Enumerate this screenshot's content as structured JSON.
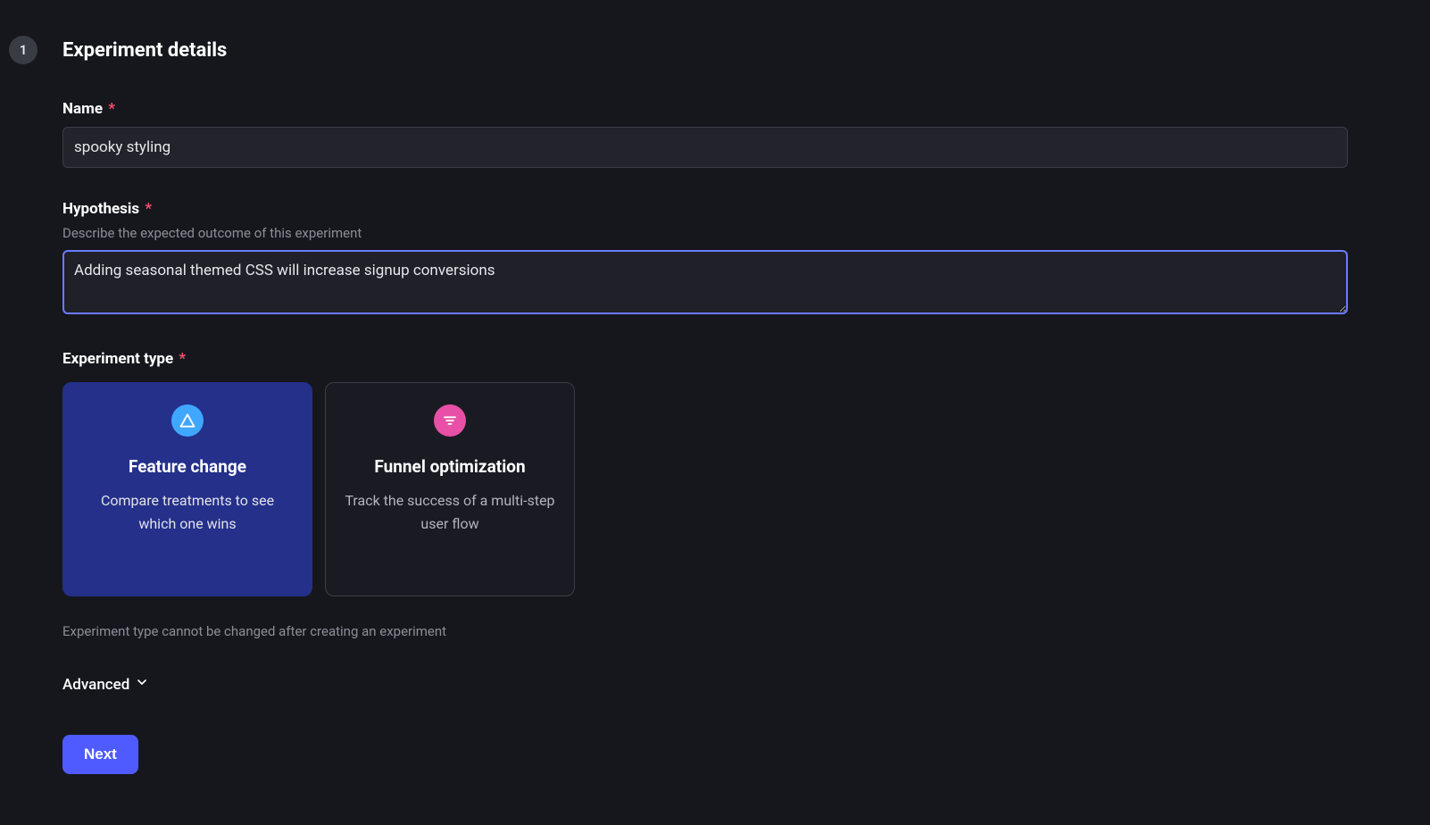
{
  "step": {
    "number": "1",
    "title": "Experiment details"
  },
  "fields": {
    "name": {
      "label": "Name",
      "value": "spooky styling"
    },
    "hypothesis": {
      "label": "Hypothesis",
      "hint": "Describe the expected outcome of this experiment",
      "value": "Adding seasonal themed CSS will increase signup conversions"
    },
    "experiment_type": {
      "label": "Experiment type",
      "note": "Experiment type cannot be changed after creating an experiment",
      "options": [
        {
          "title": "Feature change",
          "desc": "Compare treatments to see which one wins",
          "selected": true,
          "icon": "triangle"
        },
        {
          "title": "Funnel optimization",
          "desc": "Track the success of a multi-step user flow",
          "selected": false,
          "icon": "filter"
        }
      ]
    }
  },
  "advanced_label": "Advanced",
  "next_label": "Next"
}
